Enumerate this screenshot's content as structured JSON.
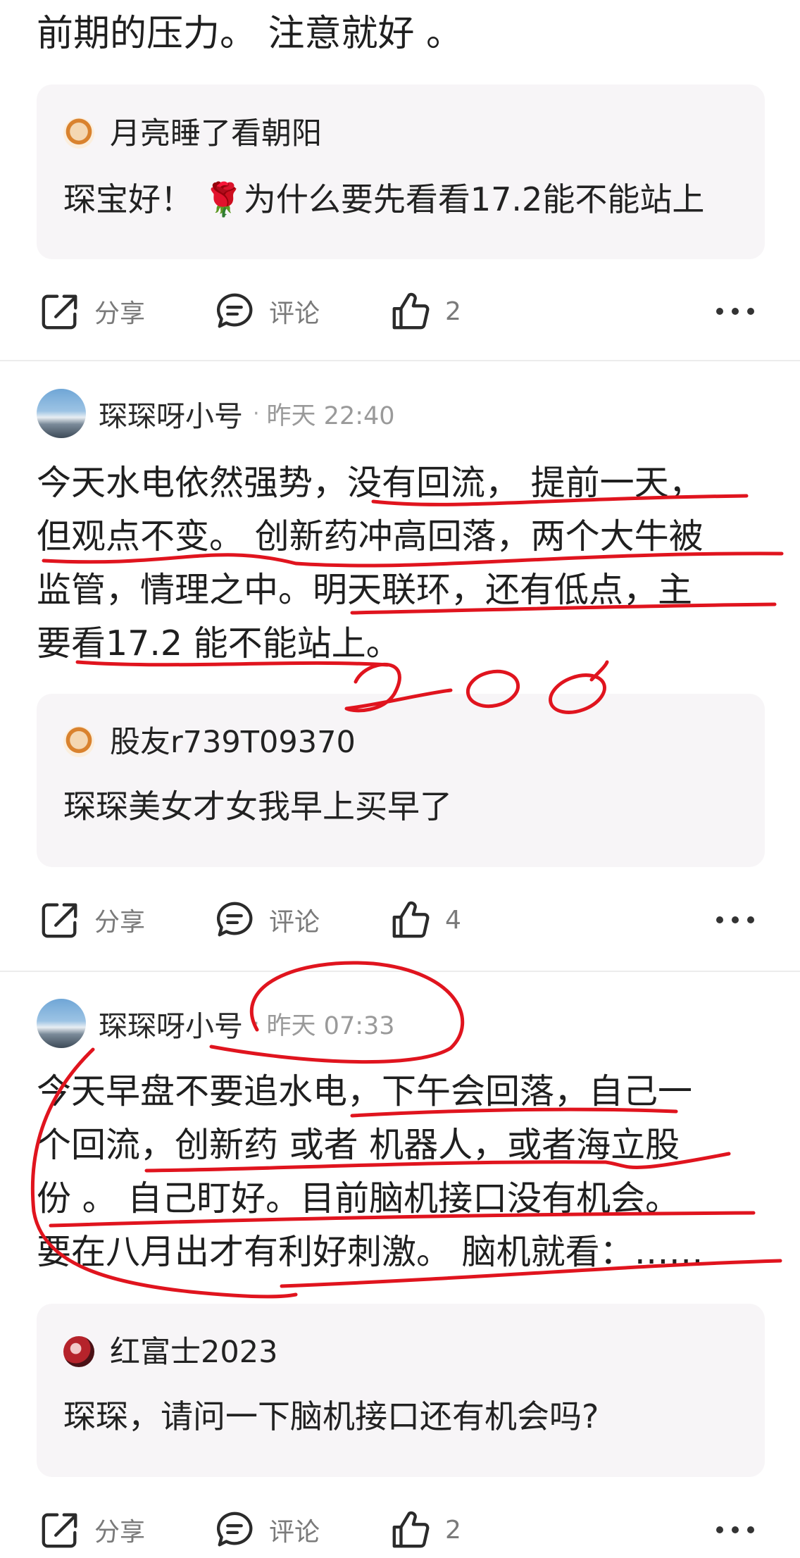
{
  "top_text": "前期的压力。 注意就好 。",
  "reply1": {
    "user": "月亮睡了看朝阳",
    "text": "琛宝好！ 🌹为什么要先看看17.2能不能站上"
  },
  "actions1": {
    "share": "分享",
    "comment": "评论",
    "likes": "2"
  },
  "post1": {
    "author": "琛琛呀小号",
    "dot": "·",
    "time": "昨天 22:40",
    "lines": [
      "今天水电依然强势，没有回流， 提前一天，",
      "但观点不变。 创新药冲高回落，两个大牛被",
      "监管，情理之中。明天联环，还有低点，主",
      "要看17.2 能不能站上。"
    ]
  },
  "reply2": {
    "user": "股友r739T09370",
    "text": "琛琛美女才女我早上买早了"
  },
  "actions2": {
    "share": "分享",
    "comment": "评论",
    "likes": "4"
  },
  "post2": {
    "author": "琛琛呀小号",
    "dot": "·",
    "time": "昨天 07:33",
    "lines": [
      "今天早盘不要追水电，下午会回落，自己一",
      "个回流，创新药 或者 机器人，或者海立股",
      "份 。 自己盯好。目前脑机接口没有机会。",
      "要在八月出才有利好刺激。 脑机就看：……"
    ]
  },
  "reply3": {
    "user": "红富士2023",
    "text": "琛琛，请问一下脑机接口还有机会吗?"
  },
  "actions3": {
    "share": "分享",
    "comment": "评论",
    "likes": "2"
  },
  "annotation_color": "#e0141e"
}
